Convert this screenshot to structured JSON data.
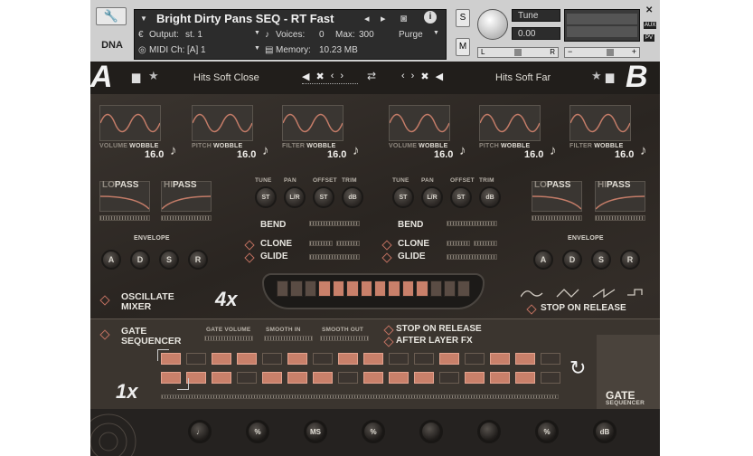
{
  "header": {
    "instrument_name": "Bright Dirty Pans SEQ - RT Fast",
    "output_label": "Output:",
    "output_value": "st. 1",
    "midi_label": "MIDI Ch:",
    "midi_value": "[A] 1",
    "voices_label": "Voices:",
    "voices_value": "0",
    "max_label": "Max:",
    "max_value": "300",
    "purge_label": "Purge",
    "memory_label": "Memory:",
    "memory_value": "10.23 MB",
    "tune_label": "Tune",
    "tune_value": "0.00",
    "s_label": "S",
    "m_label": "M",
    "l_label": "L",
    "r_label": "R",
    "aux_label": "AUX",
    "pv_label": "PV",
    "logo_text": "DNA"
  },
  "nav": {
    "layer_a_letter": "A",
    "layer_b_letter": "B",
    "preset_a": "Hits Soft Close",
    "preset_b": "Hits Soft Far"
  },
  "wobble": {
    "items": [
      {
        "label_light": "VOLUME",
        "label_bold": "WOBBLE",
        "value": "16.0"
      },
      {
        "label_light": "PITCH",
        "label_bold": "WOBBLE",
        "value": "16.0"
      },
      {
        "label_light": "FILTER",
        "label_bold": "WOBBLE",
        "value": "16.0"
      },
      {
        "label_light": "VOLUME",
        "label_bold": "WOBBLE",
        "value": "16.0"
      },
      {
        "label_light": "PITCH",
        "label_bold": "WOBBLE",
        "value": "16.0"
      },
      {
        "label_light": "FILTER",
        "label_bold": "WOBBLE",
        "value": "16.0"
      }
    ]
  },
  "filters": {
    "lo_light": "LO",
    "lo_bold": "PASS",
    "hi_light": "HI",
    "hi_bold": "PASS"
  },
  "mix": {
    "tune_label": "TUNE",
    "pan_label": "PAN",
    "offset_label": "OFFSET",
    "trim_label": "TRIM",
    "tune_knob": "ST",
    "pan_knob": "L/R",
    "offset_knob": "ST",
    "trim_knob": "dB",
    "bend_label": "BEND",
    "clone_label": "CLONE",
    "glide_label": "GLIDE",
    "envelope_label": "ENVELOPE",
    "env_a": "A",
    "env_d": "D",
    "env_s": "S",
    "env_r": "R"
  },
  "oscillate": {
    "line1": "OSCILLATE",
    "line2": "MIXER",
    "multiplier": "4x",
    "stop_on_release": "STOP ON RELEASE",
    "meter_level": 0.5
  },
  "gate": {
    "line1": "GATE",
    "line2": "SEQUENCER",
    "gate_volume": "GATE VOLUME",
    "smooth_in": "SMOOTH IN",
    "smooth_out": "SMOOTH OUT",
    "stop_on_release": "STOP ON RELEASE",
    "after_layer_fx": "AFTER LAYER FX",
    "rate": "1x",
    "badge_line1": "GATE",
    "badge_line2": "SEQUENCER",
    "row1": [
      1,
      0,
      1,
      1,
      0,
      1,
      0,
      1,
      1,
      0,
      0,
      1,
      0,
      1,
      1,
      0
    ],
    "row2": [
      1,
      1,
      1,
      0,
      1,
      1,
      1,
      0,
      1,
      1,
      1,
      0,
      1,
      1,
      1,
      0
    ]
  },
  "fx_knobs": [
    "♩",
    "%",
    "MS",
    "%",
    "",
    "",
    "%",
    "dB"
  ],
  "colors": {
    "accent": "#c9806a",
    "panel": "#2b2723",
    "header": "#cfcfcf"
  }
}
